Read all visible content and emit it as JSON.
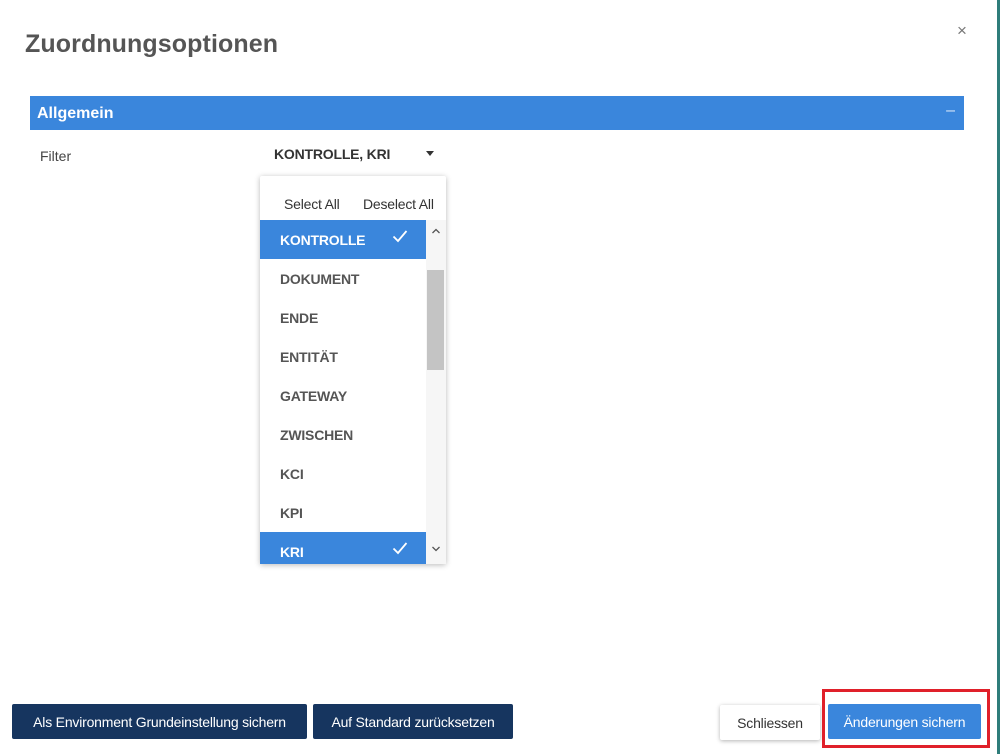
{
  "dialog": {
    "title": "Zuordnungsoptionen",
    "close_symbol": "×"
  },
  "section": {
    "title": "Allgemein",
    "collapse_symbol": "–"
  },
  "filter": {
    "label": "Filter",
    "value": "KONTROLLE, KRI"
  },
  "dropdown": {
    "select_all": "Select All",
    "deselect_all": "Deselect All",
    "options": [
      {
        "label": "KONTROLLE",
        "selected": true
      },
      {
        "label": "DOKUMENT",
        "selected": false
      },
      {
        "label": "ENDE",
        "selected": false
      },
      {
        "label": "ENTITÄT",
        "selected": false
      },
      {
        "label": "GATEWAY",
        "selected": false
      },
      {
        "label": "ZWISCHEN",
        "selected": false
      },
      {
        "label": "KCI",
        "selected": false
      },
      {
        "label": "KPI",
        "selected": false
      },
      {
        "label": "KRI",
        "selected": true
      }
    ]
  },
  "footer": {
    "save_env_label": "Als Environment Grundeinstellung sichern",
    "reset_label": "Auf Standard zurücksetzen",
    "close_label": "Schliessen",
    "save_label": "Änderungen sichern"
  },
  "colors": {
    "accent": "#3a86dc",
    "dark_button": "#16355f",
    "highlight": "#e0202a"
  }
}
